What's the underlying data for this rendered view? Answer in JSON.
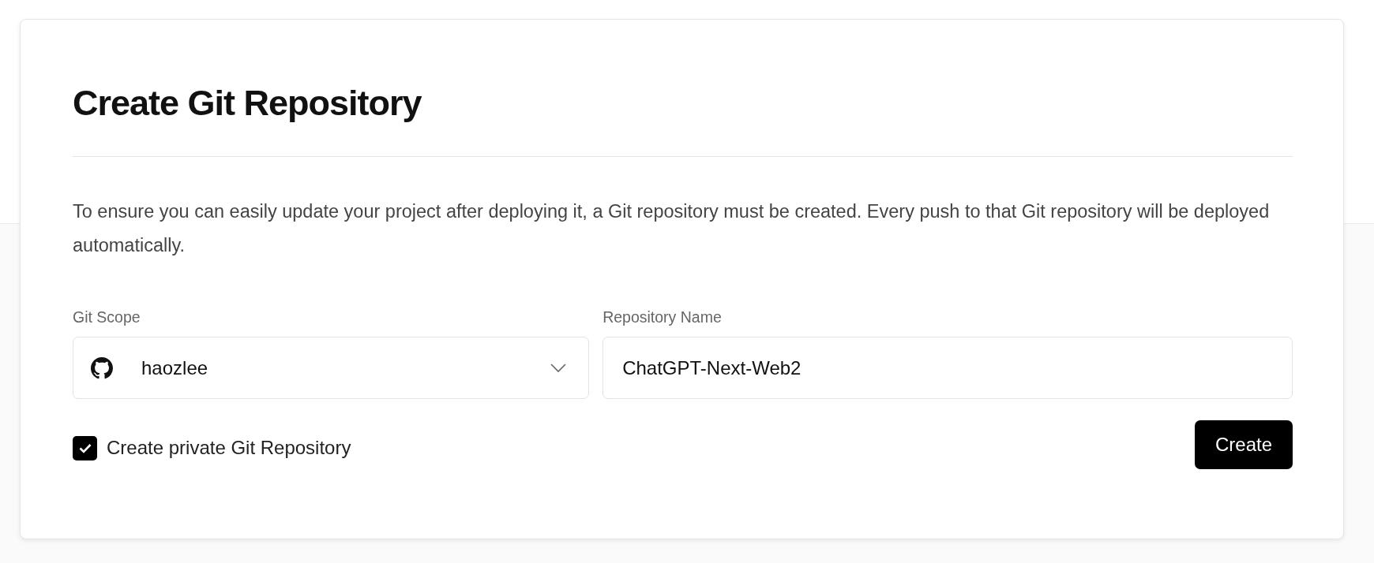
{
  "dialog": {
    "title": "Create Git Repository",
    "description": "To ensure you can easily update your project after deploying it, a Git repository must be created. Every push to that Git repository will be deployed automatically.",
    "git_scope": {
      "label": "Git Scope",
      "value": "haozlee"
    },
    "repository_name": {
      "label": "Repository Name",
      "value": "ChatGPT-Next-Web2"
    },
    "private_checkbox": {
      "label": "Create private Git Repository",
      "checked": true
    },
    "buttons": [
      "Create"
    ]
  }
}
